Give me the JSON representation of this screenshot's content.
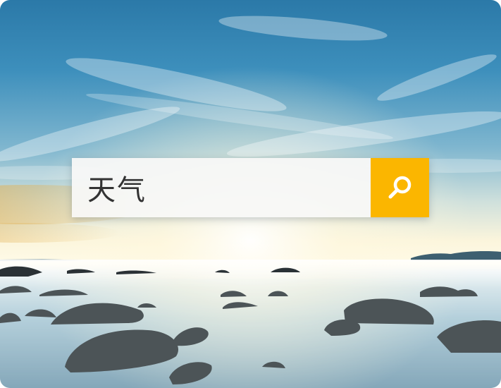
{
  "search": {
    "query": "天气",
    "button_icon": "search-icon",
    "button_color": "#fbb600"
  },
  "background": {
    "description_icon": "seascape-background-image"
  }
}
